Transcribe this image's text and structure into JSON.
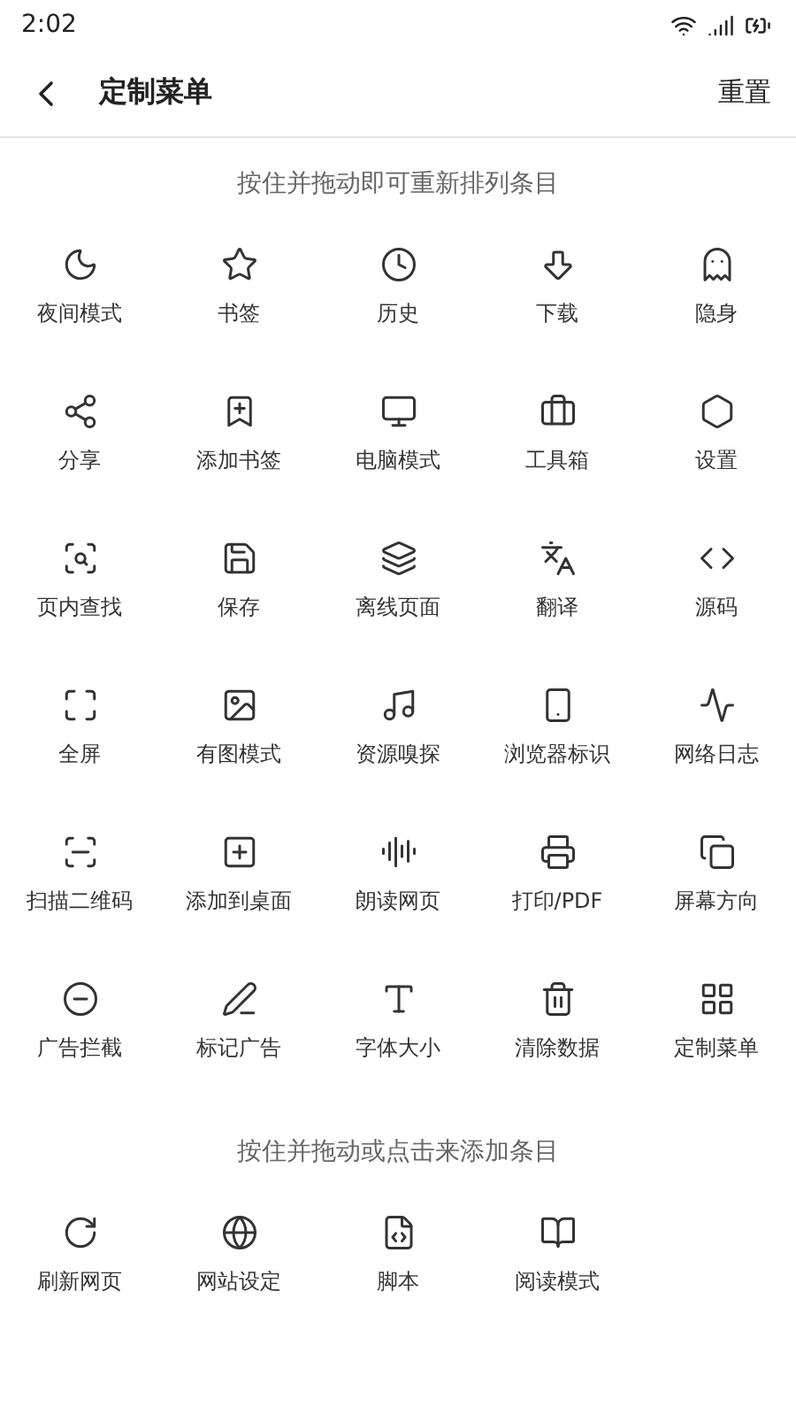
{
  "status_bar": {
    "time": "2:02"
  },
  "header": {
    "title": "定制菜单",
    "action": "重置"
  },
  "active_section": {
    "hint": "按住并拖动即可重新排列条目",
    "items": [
      {
        "label": "夜间模式"
      },
      {
        "label": "书签"
      },
      {
        "label": "历史"
      },
      {
        "label": "下载"
      },
      {
        "label": "隐身"
      },
      {
        "label": "分享"
      },
      {
        "label": "添加书签"
      },
      {
        "label": "电脑模式"
      },
      {
        "label": "工具箱"
      },
      {
        "label": "设置"
      },
      {
        "label": "页内查找"
      },
      {
        "label": "保存"
      },
      {
        "label": "离线页面"
      },
      {
        "label": "翻译"
      },
      {
        "label": "源码"
      },
      {
        "label": "全屏"
      },
      {
        "label": "有图模式"
      },
      {
        "label": "资源嗅探"
      },
      {
        "label": "浏览器标识"
      },
      {
        "label": "网络日志"
      },
      {
        "label": "扫描二维码"
      },
      {
        "label": "添加到桌面"
      },
      {
        "label": "朗读网页"
      },
      {
        "label": "打印/PDF"
      },
      {
        "label": "屏幕方向"
      },
      {
        "label": "广告拦截"
      },
      {
        "label": "标记广告"
      },
      {
        "label": "字体大小"
      },
      {
        "label": "清除数据"
      },
      {
        "label": "定制菜单"
      }
    ]
  },
  "available_section": {
    "hint": "按住并拖动或点击来添加条目",
    "items": [
      {
        "label": "刷新网页"
      },
      {
        "label": "网站设定"
      },
      {
        "label": "脚本"
      },
      {
        "label": "阅读模式"
      }
    ]
  }
}
